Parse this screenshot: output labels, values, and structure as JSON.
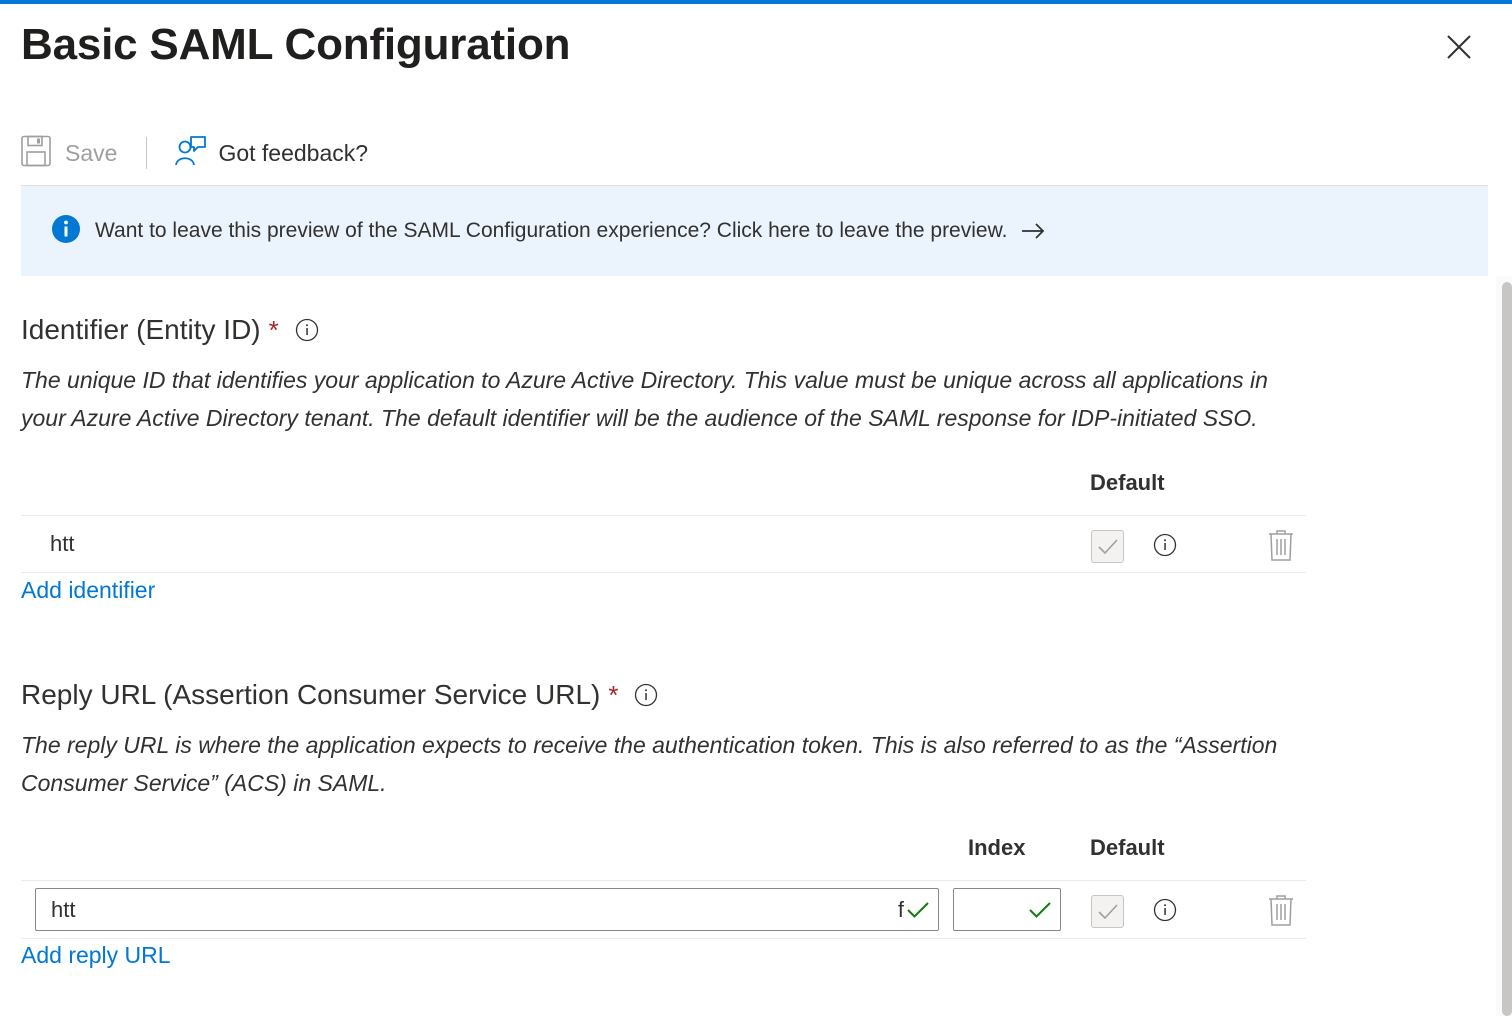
{
  "panel": {
    "title": "Basic SAML Configuration"
  },
  "toolbar": {
    "save_label": "Save",
    "feedback_label": "Got feedback?"
  },
  "banner": {
    "message": "Want to leave this preview of the SAML Configuration experience? Click here to leave the preview."
  },
  "identifier": {
    "title": "Identifier (Entity ID)",
    "required_mark": "*",
    "description": "The unique ID that identifies your application to Azure Active Directory. This value must be unique across all applications in your Azure Active Directory tenant. The default identifier will be the audience of the SAML response for IDP-initiated SSO.",
    "col_default": "Default",
    "rows": [
      {
        "value": "htt"
      }
    ],
    "add_link": "Add identifier"
  },
  "reply_url": {
    "title": "Reply URL (Assertion Consumer Service URL)",
    "required_mark": "*",
    "description": "The reply URL is where the application expects to receive the authentication token. This is also referred to as the “Assertion Consumer Service” (ACS) in SAML.",
    "col_index": "Index",
    "col_default": "Default",
    "rows": [
      {
        "value": "htt",
        "value_tail": "f",
        "index": ""
      }
    ],
    "add_link": "Add reply URL"
  },
  "colors": {
    "accent": "#0078d4",
    "banner_bg": "#ebf3fc",
    "required": "#a4262c",
    "valid_check": "#107c10"
  },
  "icons": {
    "close": "close-icon",
    "save": "save-icon",
    "feedback": "feedback-icon",
    "banner_info": "info-circle-icon",
    "arrow": "arrow-right-icon",
    "info": "info-icon",
    "trash": "trash-icon",
    "check": "checkmark-icon"
  }
}
